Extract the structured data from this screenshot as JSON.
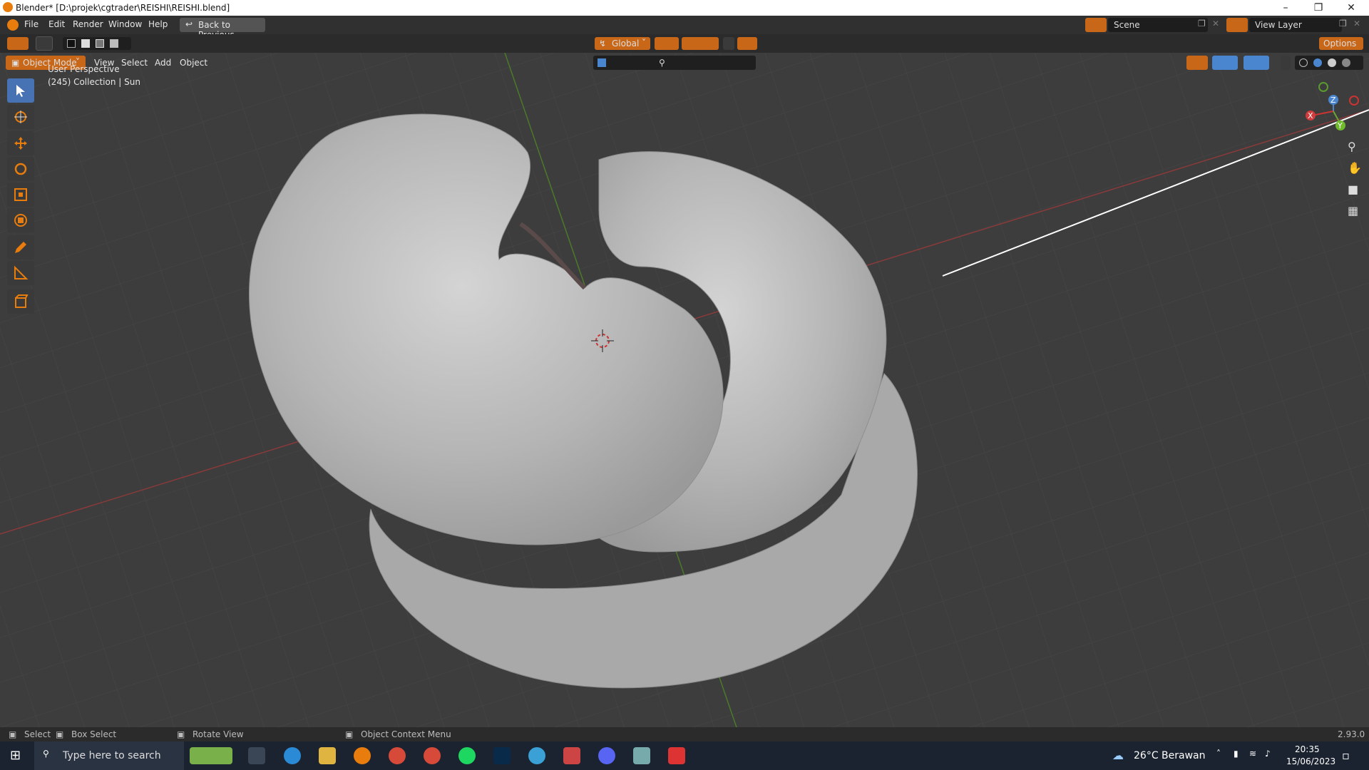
{
  "window": {
    "title": "Blender* [D:\\projek\\cgtrader\\REISHI\\REISHI.blend]"
  },
  "menu": {
    "items": [
      "File",
      "Edit",
      "Render",
      "Window",
      "Help"
    ],
    "back_label": "Back to Previous",
    "scene_label": "Scene",
    "view_layer_label": "View Layer"
  },
  "header": {
    "transform_orientation": "Global",
    "options_label": "Options",
    "mode": "Object Mode",
    "menus": [
      "View",
      "Select",
      "Add",
      "Object"
    ]
  },
  "viewport": {
    "perspective": "User Perspective",
    "collection_info": "(245) Collection | Sun",
    "gizmo_axes": [
      "Z",
      "X",
      "Y"
    ]
  },
  "tools": [
    "select-box",
    "cursor",
    "move",
    "rotate",
    "scale",
    "transform",
    "annotate",
    "measure",
    "add-cube"
  ],
  "statusbar": {
    "select": "Select",
    "box_select": "Box Select",
    "rotate_view": "Rotate View",
    "context_menu": "Object Context Menu",
    "version": "2.93.0"
  },
  "taskbar": {
    "search_placeholder": "Type here to search",
    "weather": "26°C  Berawan",
    "time": "20:35",
    "date": "15/06/2023"
  },
  "colors": {
    "accent": "#e87d0d",
    "active_tool": "#4772b3",
    "viewport_bg": "#3d3d3d"
  }
}
